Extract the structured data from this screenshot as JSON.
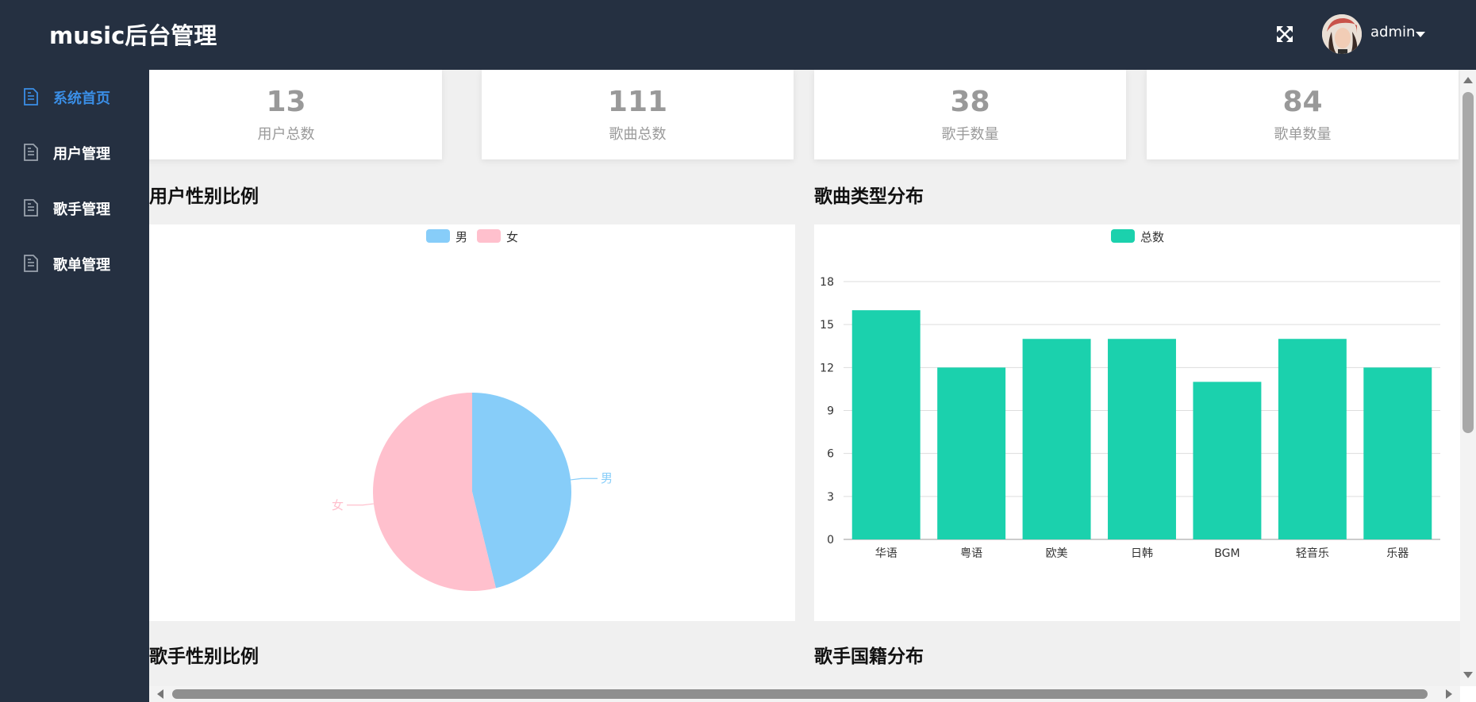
{
  "header": {
    "title": "music后台管理",
    "username": "admin"
  },
  "sidebar": {
    "items": [
      {
        "label": "系统首页",
        "active": true
      },
      {
        "label": "用户管理",
        "active": false
      },
      {
        "label": "歌手管理",
        "active": false
      },
      {
        "label": "歌单管理",
        "active": false
      }
    ]
  },
  "stats": [
    {
      "value": "13",
      "label": "用户总数"
    },
    {
      "value": "111",
      "label": "歌曲总数"
    },
    {
      "value": "38",
      "label": "歌手数量"
    },
    {
      "value": "84",
      "label": "歌单数量"
    }
  ],
  "sections": {
    "user_gender": "用户性别比例",
    "song_types": "歌曲类型分布",
    "singer_gender": "歌手性别比例",
    "singer_nationality": "歌手国籍分布"
  },
  "colors": {
    "nav_bg": "#253041",
    "accent": "#3a8ee6",
    "male": "#87cdf9",
    "female": "#ffc0cd",
    "bar": "#1bd1ad"
  },
  "chart_data": [
    {
      "type": "pie",
      "title": "用户性别比例",
      "legend": [
        "男",
        "女"
      ],
      "slices": [
        {
          "name": "男",
          "value": 6,
          "color": "#87cdf9"
        },
        {
          "name": "女",
          "value": 7,
          "color": "#ffc0cd"
        }
      ]
    },
    {
      "type": "bar",
      "title": "歌曲类型分布",
      "legend": [
        "总数"
      ],
      "categories": [
        "华语",
        "粤语",
        "欧美",
        "日韩",
        "BGM",
        "轻音乐",
        "乐器"
      ],
      "series": [
        {
          "name": "总数",
          "values": [
            16,
            12,
            14,
            14,
            11,
            14,
            12
          ]
        }
      ],
      "ylim": [
        0,
        18
      ],
      "yticks": [
        0,
        3,
        6,
        9,
        12,
        15,
        18
      ],
      "grid": true,
      "legend_position": "top-center"
    }
  ]
}
